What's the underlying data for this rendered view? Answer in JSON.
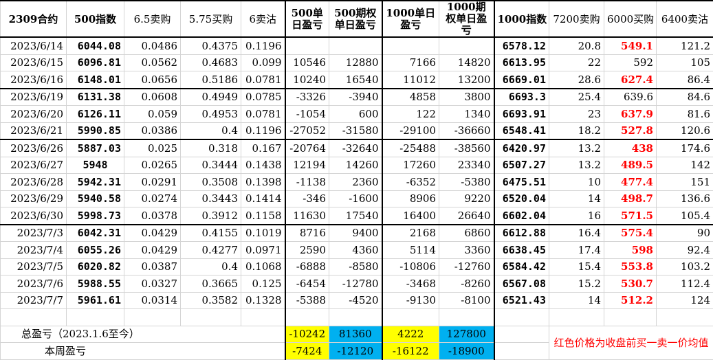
{
  "headers": {
    "contract": "2309合约",
    "idx500": "500指数",
    "sell65": "6.5卖购",
    "buy575": "5.75买购",
    "sell6": "6卖沽",
    "daily500": "500单日盈亏",
    "opt500": "500期权单日盈亏",
    "daily1000": "1000单日盈亏",
    "opt1000": "1000期权单日盈亏",
    "idx1000": "1000指数",
    "sell7200": "7200卖购",
    "buy6000": "6000买购",
    "sell6400": "6400卖沽"
  },
  "rows": [
    {
      "date": "2023/6/14",
      "i500": "6044.08",
      "a": "0.0486",
      "b": "0.4375",
      "c": "0.1196",
      "d500": "",
      "o500": "",
      "d1000": "",
      "o1000": "",
      "i1000": "6578.12",
      "e": "20.8",
      "f": "549.1",
      "fred": true,
      "g": "121.2"
    },
    {
      "date": "2023/6/15",
      "i500": "6096.81",
      "a": "0.0562",
      "b": "0.4683",
      "c": "0.099",
      "d500": "10546",
      "o500": "12880",
      "d1000": "7166",
      "o1000": "14820",
      "i1000": "6613.95",
      "e": "22",
      "f": "592",
      "fred": false,
      "g": "105"
    },
    {
      "date": "2023/6/16",
      "i500": "6148.01",
      "a": "0.0656",
      "b": "0.5186",
      "c": "0.0781",
      "d500": "10240",
      "o500": "16540",
      "d1000": "11012",
      "o1000": "13200",
      "i1000": "6669.01",
      "e": "28.6",
      "f": "627.4",
      "fred": true,
      "g": "86.4"
    },
    {
      "date": "2023/6/19",
      "i500": "6131.38",
      "a": "0.0608",
      "b": "0.4949",
      "c": "0.0785",
      "d500": "-3326",
      "o500": "-3940",
      "d1000": "4858",
      "o1000": "3800",
      "i1000": "6693.3",
      "e": "25.4",
      "f": "639.6",
      "fred": false,
      "g": "84.6"
    },
    {
      "date": "2023/6/20",
      "i500": "6126.11",
      "a": "0.059",
      "b": "0.4953",
      "c": "0.0781",
      "d500": "-1054",
      "o500": "600",
      "d1000": "122",
      "o1000": "1340",
      "i1000": "6693.91",
      "e": "23",
      "f": "637.9",
      "fred": true,
      "g": "81.6"
    },
    {
      "date": "2023/6/21",
      "i500": "5990.85",
      "a": "0.0386",
      "b": "0.4",
      "c": "0.1196",
      "d500": "-27052",
      "o500": "-31580",
      "d1000": "-29100",
      "o1000": "-36660",
      "i1000": "6548.41",
      "e": "18.2",
      "f": "527.8",
      "fred": true,
      "g": "120.6"
    },
    {
      "date": "2023/6/26",
      "i500": "5887.03",
      "a": "0.025",
      "b": "0.318",
      "c": "0.167",
      "d500": "-20764",
      "o500": "-32640",
      "d1000": "-25488",
      "o1000": "-38560",
      "i1000": "6420.97",
      "e": "13.2",
      "f": "438",
      "fred": true,
      "g": "174.6"
    },
    {
      "date": "2023/6/27",
      "i500": "5948",
      "a": "0.0265",
      "b": "0.3444",
      "c": "0.1438",
      "d500": "12194",
      "o500": "14260",
      "d1000": "17260",
      "o1000": "23340",
      "i1000": "6507.27",
      "e": "13.2",
      "f": "489.5",
      "fred": true,
      "g": "142"
    },
    {
      "date": "2023/6/28",
      "i500": "5942.31",
      "a": "0.0291",
      "b": "0.3508",
      "c": "0.1398",
      "d500": "-1138",
      "o500": "2360",
      "d1000": "-6352",
      "o1000": "-5380",
      "i1000": "6475.51",
      "e": "10",
      "f": "477.4",
      "fred": true,
      "g": "151"
    },
    {
      "date": "2023/6/29",
      "i500": "5940.58",
      "a": "0.0274",
      "b": "0.3443",
      "c": "0.1414",
      "d500": "-346",
      "o500": "-1600",
      "d1000": "8906",
      "o1000": "9220",
      "i1000": "6520.04",
      "e": "14",
      "f": "498.7",
      "fred": true,
      "g": "136.6"
    },
    {
      "date": "2023/6/30",
      "i500": "5998.73",
      "a": "0.0378",
      "b": "0.3912",
      "c": "0.1158",
      "d500": "11630",
      "o500": "17540",
      "d1000": "16400",
      "o1000": "26640",
      "i1000": "6602.04",
      "e": "16",
      "f": "571.5",
      "fred": true,
      "g": "105.4"
    },
    {
      "date": "2023/7/3",
      "i500": "6042.31",
      "a": "0.0429",
      "b": "0.4155",
      "c": "0.1019",
      "d500": "8716",
      "o500": "9400",
      "d1000": "2168",
      "o1000": "6860",
      "i1000": "6612.88",
      "e": "16.4",
      "f": "575.4",
      "fred": true,
      "g": "90"
    },
    {
      "date": "2023/7/4",
      "i500": "6055.26",
      "a": "0.0429",
      "b": "0.4277",
      "c": "0.0971",
      "d500": "2590",
      "o500": "4360",
      "d1000": "5114",
      "o1000": "3360",
      "i1000": "6638.45",
      "e": "17.4",
      "f": "598",
      "fred": true,
      "g": "92.4"
    },
    {
      "date": "2023/7/5",
      "i500": "6020.82",
      "a": "0.0387",
      "b": "0.4",
      "c": "0.1068",
      "d500": "-6888",
      "o500": "-8580",
      "d1000": "-10806",
      "o1000": "-12760",
      "i1000": "6584.42",
      "e": "15.4",
      "f": "553.8",
      "fred": true,
      "g": "103.2"
    },
    {
      "date": "2023/7/6",
      "i500": "5988.55",
      "a": "0.0327",
      "b": "0.3665",
      "c": "0.125",
      "d500": "-6454",
      "o500": "-12780",
      "d1000": "-3468",
      "o1000": "-8260",
      "i1000": "6567.08",
      "e": "15.2",
      "f": "530.7",
      "fred": true,
      "g": "112.4"
    },
    {
      "date": "2023/7/7",
      "i500": "5961.61",
      "a": "0.0314",
      "b": "0.3582",
      "c": "0.1328",
      "d500": "-5388",
      "o500": "-4520",
      "d1000": "-9130",
      "o1000": "-8100",
      "i1000": "6521.43",
      "e": "14",
      "f": "512.2",
      "fred": true,
      "g": "124"
    }
  ],
  "summary": {
    "total_label": "总盈亏（2023.1.6至今）",
    "week_label": "本周盈亏",
    "total_d500": "-10242",
    "total_o500": "81360",
    "total_d1000": "4222",
    "total_o1000": "127800",
    "week_d500": "-7424",
    "week_o500": "-12120",
    "week_d1000": "-16122",
    "week_o1000": "-18900",
    "note": "红色价格为收盘前买一卖一价均值"
  },
  "colors": {
    "red": "#ff0000",
    "yellow": "#ffff00",
    "blue": "#00b0f0"
  }
}
